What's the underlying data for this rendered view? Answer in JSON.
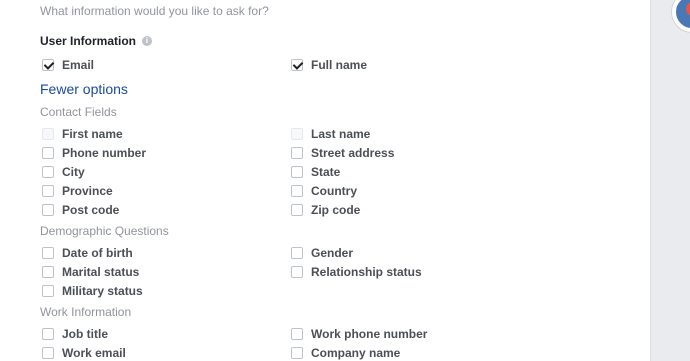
{
  "prompt": "What information would you like to ask for?",
  "user_info": {
    "title": "User Information",
    "info_icon": "i",
    "email": "Email",
    "full_name": "Full name"
  },
  "fewer_options": "Fewer options",
  "contact": {
    "label": "Contact Fields",
    "first_name": "First name",
    "last_name": "Last name",
    "phone": "Phone number",
    "street": "Street address",
    "city": "City",
    "state": "State",
    "province": "Province",
    "country": "Country",
    "post_code": "Post code",
    "zip_code": "Zip code"
  },
  "demographic": {
    "label": "Demographic Questions",
    "dob": "Date of birth",
    "gender": "Gender",
    "marital": "Marital status",
    "relationship": "Relationship status",
    "military": "Military status"
  },
  "work": {
    "label": "Work Information",
    "job_title": "Job title",
    "work_phone": "Work phone number",
    "work_email": "Work email",
    "company": "Company name"
  },
  "checked": [
    "Email",
    "Full name"
  ],
  "colors": {
    "link": "#1c4a9c",
    "muted": "#90949c",
    "text": "#4b4f56"
  }
}
